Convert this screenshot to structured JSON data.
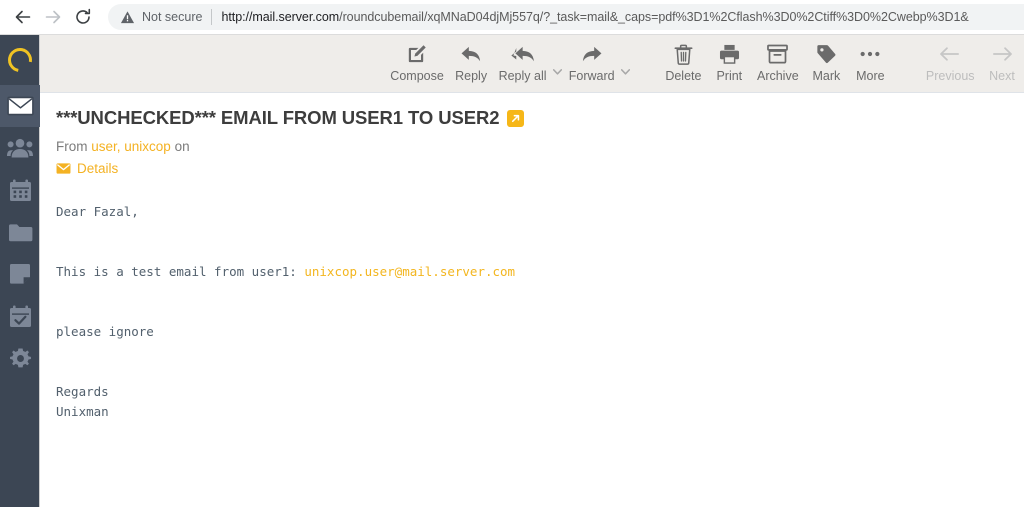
{
  "browser": {
    "back_icon": "arrow-left-icon",
    "forward_icon": "arrow-right-icon",
    "reload_icon": "reload-icon",
    "security_icon": "warning-triangle-icon",
    "security_label": "Not secure",
    "url_host": "http://mail.server.com",
    "url_path": "/roundcubemail/xqMNaD04djMj557q/?_task=mail&_caps=pdf%3D1%2Cflash%3D0%2Ctiff%3D0%2Cwebp%3D1&",
    "url_full": "http://mail.server.com/roundcubemail/xqMNaD04djMj557q/?_task=mail&_caps=pdf%3D1%2Cflash%3D0%2Ctiff%3D0%2Cwebp%3D1&"
  },
  "sidebar": {
    "logo": "roundcube-logo",
    "items": [
      {
        "name": "mail",
        "icon": "envelope-icon",
        "active": true
      },
      {
        "name": "contacts",
        "icon": "people-icon",
        "active": false
      },
      {
        "name": "calendar",
        "icon": "calendar-icon",
        "active": false
      },
      {
        "name": "files",
        "icon": "folder-icon",
        "active": false
      },
      {
        "name": "notes",
        "icon": "note-icon",
        "active": false
      },
      {
        "name": "tasks",
        "icon": "tasks-checkbox-icon",
        "active": false
      },
      {
        "name": "settings",
        "icon": "gear-icon",
        "active": false
      }
    ]
  },
  "toolbar": {
    "compose": {
      "label": "Compose",
      "icon": "compose-pencil-icon",
      "disabled": false
    },
    "reply": {
      "label": "Reply",
      "icon": "reply-arrow-icon",
      "disabled": false
    },
    "reply_all": {
      "label": "Reply all",
      "icon": "reply-all-arrow-icon",
      "disabled": false
    },
    "forward": {
      "label": "Forward",
      "icon": "forward-arrow-icon",
      "disabled": false
    },
    "delete": {
      "label": "Delete",
      "icon": "trash-icon",
      "disabled": false
    },
    "print": {
      "label": "Print",
      "icon": "printer-icon",
      "disabled": false
    },
    "archive": {
      "label": "Archive",
      "icon": "archive-box-icon",
      "disabled": false
    },
    "mark": {
      "label": "Mark",
      "icon": "tag-icon",
      "disabled": false
    },
    "more": {
      "label": "More",
      "icon": "ellipsis-icon",
      "disabled": false
    },
    "previous": {
      "label": "Previous",
      "icon": "arrow-left-icon",
      "disabled": true
    },
    "next": {
      "label": "Next",
      "icon": "arrow-right-icon",
      "disabled": true
    },
    "caret_icon": "chevron-down-icon"
  },
  "message": {
    "subject": "***UNCHECKED*** EMAIL FROM USER1 TO USER2",
    "open_window_icon": "open-in-new-window-icon",
    "from_prefix": "From",
    "from_sender": "user, unixcop",
    "from_suffix": "on",
    "details_label": "Details",
    "details_icon": "envelope-icon",
    "body_greeting": "Dear Fazal,",
    "body_line_prefix": "This is a test email from user1: ",
    "body_link": "unixcop.user@mail.server.com",
    "body_note": "please ignore",
    "body_signoff": "Regards",
    "body_signature": "Unixman"
  },
  "colors": {
    "accent": "#f4b223",
    "sidebar_bg": "#3c4654",
    "sidebar_active": "#4d5869",
    "toolbar_bg": "#efedea",
    "text_muted": "#7c7c7c"
  }
}
